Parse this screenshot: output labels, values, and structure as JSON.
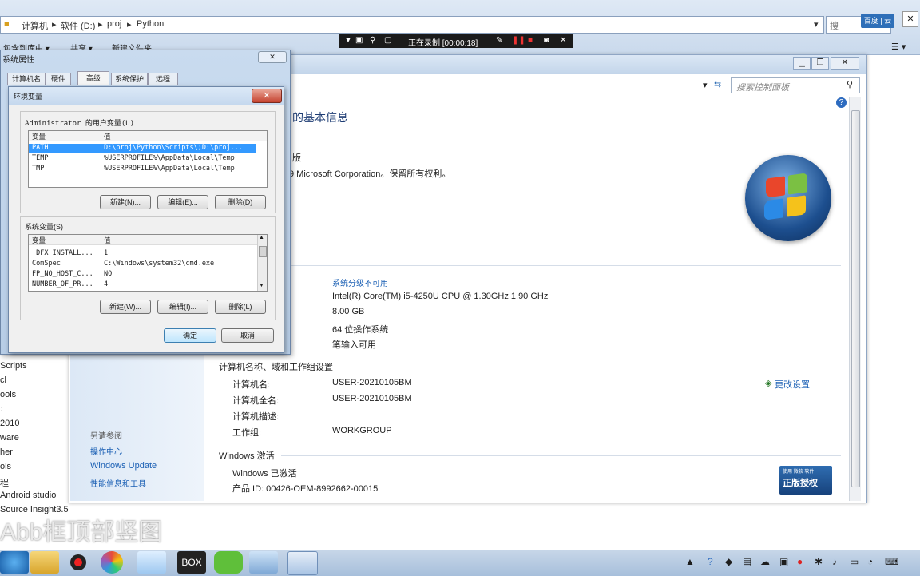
{
  "explorer": {
    "breadcrumb": [
      "计算机",
      "软件 (D:)",
      "proj",
      "Python"
    ],
    "toolbar_left": "包含到库中 ▾",
    "toolbar_share": "共享 ▾",
    "toolbar_newfolder": "新建文件夹",
    "search_placeholder": "搜",
    "left_items": [
      "bs",
      "Scripts",
      "cl",
      "ools",
      ":",
      "2010",
      "ware",
      "her",
      "ols",
      "程",
      "Android studio",
      "Source Insight3.5"
    ]
  },
  "recorder": {
    "status": "正在录制 [00:00:18]"
  },
  "tray_app": {
    "label": "百度 | 云"
  },
  "control_panel": {
    "search_placeholder": "搜索控制面板",
    "heading": "的基本信息",
    "edition_label": "版",
    "copyright": "9 Microsoft Corporation。保留所有权利。",
    "rating": "系统分级不可用",
    "processor": "Intel(R) Core(TM) i5-4250U CPU @ 1.30GHz   1.90 GHz",
    "memory": "8.00 GB",
    "system_type": "64 位操作系统",
    "pen_touch": "笔输入可用",
    "section_computer": "计算机名称、域和工作组设置",
    "computer_name_label": "计算机名:",
    "computer_name": "USER-20210105BM",
    "full_name_label": "计算机全名:",
    "full_name": "USER-20210105BM",
    "description_label": "计算机描述:",
    "workgroup_label": "工作组:",
    "workgroup": "WORKGROUP",
    "change_settings": "更改设置",
    "section_activation": "Windows 激活",
    "activated": "Windows 已激活",
    "product_id": "产品 ID: 00426-OEM-8992662-00015",
    "genuine_badge": "正版授权",
    "genuine_small": "使用 微软 软件",
    "left_see_also": "另请参阅",
    "left_action_center": "操作中心",
    "left_windows_update": "Windows Update",
    "left_perf": "性能信息和工具"
  },
  "system_properties": {
    "title": "系统属性",
    "tabs": [
      "计算机名",
      "硬件",
      "高级",
      "系统保护",
      "远程"
    ]
  },
  "env_dialog": {
    "title": "环境变量",
    "user_group_label": "Administrator 的用户变量(U)",
    "col_var": "变量",
    "col_val": "值",
    "user_vars": [
      {
        "name": "PATH",
        "value": "D:\\proj\\Python\\Scripts\\;D:\\proj..."
      },
      {
        "name": "TEMP",
        "value": "%USERPROFILE%\\AppData\\Local\\Temp"
      },
      {
        "name": "TMP",
        "value": "%USERPROFILE%\\AppData\\Local\\Temp"
      }
    ],
    "sys_group_label": "系统变量(S)",
    "sys_vars": [
      {
        "name": "_DFX_INSTALL...",
        "value": "1"
      },
      {
        "name": "ComSpec",
        "value": "C:\\Windows\\system32\\cmd.exe"
      },
      {
        "name": "FP_NO_HOST_C...",
        "value": "NO"
      },
      {
        "name": "NUMBER_OF_PR...",
        "value": "4"
      }
    ],
    "btn_new_user": "新建(N)...",
    "btn_edit_user": "编辑(E)...",
    "btn_delete_user": "删除(D)",
    "btn_new_sys": "新建(W)...",
    "btn_edit_sys": "编辑(I)...",
    "btn_delete_sys": "删除(L)",
    "btn_ok": "确定",
    "btn_cancel": "取消"
  },
  "watermark": "Abb框顶部竖图",
  "taskbar": {
    "icons": [
      "ie-icon",
      "folder-icon",
      "recorder-icon",
      "photos-icon",
      "baidu-cloud-icon",
      "box-icon",
      "wechat-icon",
      "control-panel-icon",
      "system-properties-icon"
    ]
  }
}
